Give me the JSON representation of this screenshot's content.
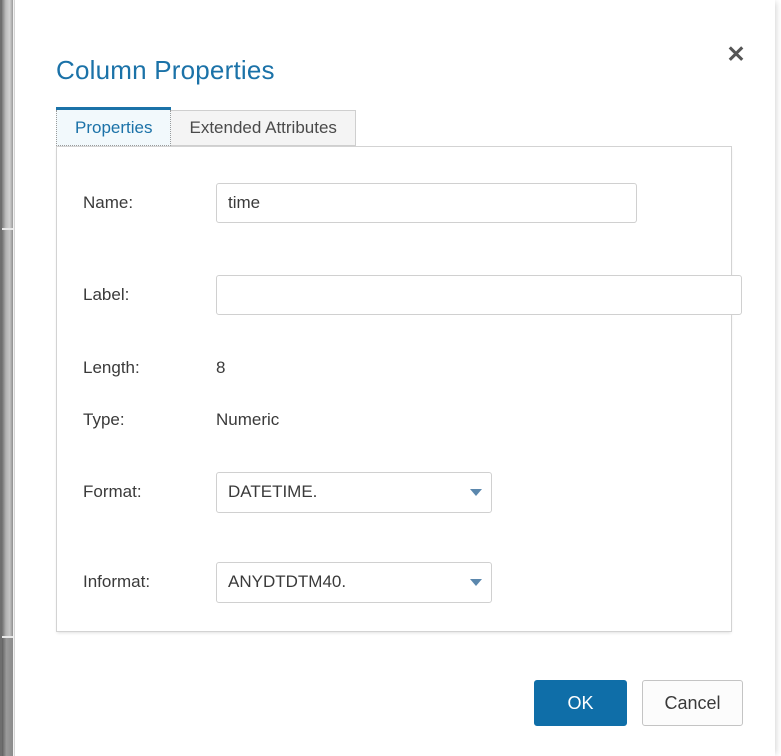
{
  "dialog": {
    "title": "Column Properties",
    "close_icon": "close-icon",
    "close_label": "✕"
  },
  "tabs": [
    {
      "label": "Properties",
      "active": true
    },
    {
      "label": "Extended Attributes",
      "active": false
    }
  ],
  "form": {
    "name": {
      "label": "Name:",
      "value": "time",
      "placeholder": ""
    },
    "label_field": {
      "label": "Label:",
      "value": "",
      "placeholder": ""
    },
    "length": {
      "label": "Length:",
      "value": "8"
    },
    "type": {
      "label": "Type:",
      "value": "Numeric"
    },
    "format": {
      "label": "Format:",
      "value": "DATETIME.",
      "arrow_icon": "chevron-down-icon"
    },
    "informat": {
      "label": "Informat:",
      "value": "ANYDTDTM40.",
      "arrow_icon": "chevron-down-icon"
    }
  },
  "footer": {
    "ok_label": "OK",
    "cancel_label": "Cancel"
  },
  "colors": {
    "accent": "#1b72a8",
    "primary_button": "#0f6ea8",
    "dropdown_arrow": "#5b87ad",
    "border": "#d0d0d0",
    "text": "#3a3a3a"
  }
}
